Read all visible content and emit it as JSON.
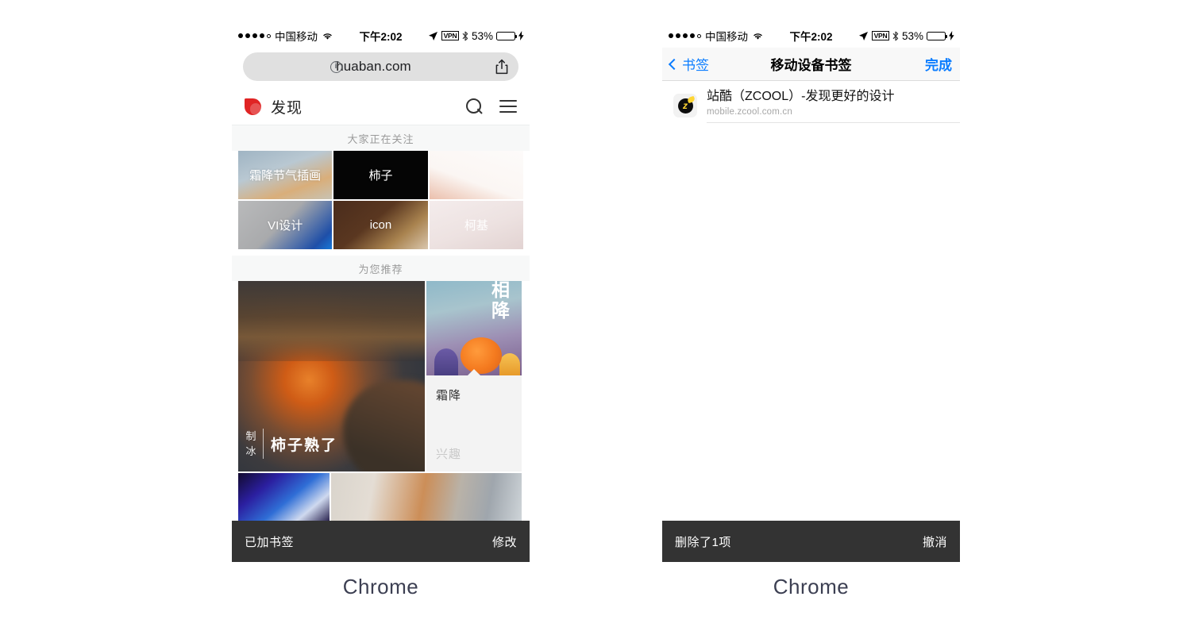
{
  "panels": [
    {
      "caption": "Chrome",
      "status_bar": {
        "signal_dots_filled": 4,
        "signal_dots_total": 5,
        "carrier": "中国移动",
        "wifi_icon": "wifi-icon",
        "time": "下午2:02",
        "location_icon": "location-arrow-icon",
        "vpn_label": "VPN",
        "bluetooth_icon": "bluetooth-icon",
        "battery_percent": "53%",
        "battery_fill": 55,
        "charging_icon": "lightning-bolt-icon"
      },
      "urlbar": {
        "info_icon": "info-circle-icon",
        "url": "huaban.com",
        "share_icon": "share-icon"
      },
      "site_header": {
        "logo_icon": "huaban-petal-logo",
        "title": "发现",
        "search_icon": "search-icon",
        "menu_icon": "hamburger-menu-icon"
      },
      "sections": [
        {
          "label": "大家正在关注"
        },
        {
          "label": "为您推荐"
        }
      ],
      "tags": [
        {
          "label": "霜降节气插画",
          "tone": "t1"
        },
        {
          "label": "柿子",
          "tone": "t2"
        },
        {
          "label": "",
          "tone": "t3"
        },
        {
          "label": "VI设计",
          "tone": "t4"
        },
        {
          "label": "icon",
          "tone": "t5"
        },
        {
          "label": "柯基",
          "tone": "t6"
        }
      ],
      "feed": {
        "main_photo_seal": "制\n冰",
        "main_photo_title": "柿子熟了",
        "illustration_text": "相\n降",
        "card_title": "霜降",
        "card_tag": "兴趣"
      },
      "toast": {
        "message": "已加书签",
        "action": "修改"
      }
    },
    {
      "caption": "Chrome",
      "status_bar": {
        "signal_dots_filled": 4,
        "signal_dots_total": 5,
        "carrier": "中国移动",
        "wifi_icon": "wifi-icon",
        "time": "下午2:02",
        "location_icon": "location-arrow-icon",
        "vpn_label": "VPN",
        "bluetooth_icon": "bluetooth-icon",
        "battery_percent": "53%",
        "battery_fill": 55,
        "charging_icon": "lightning-bolt-icon"
      },
      "navbar": {
        "back_icon": "chevron-left-icon",
        "back_label": "书签",
        "title": "移动设备书签",
        "done_label": "完成"
      },
      "bookmarks": [
        {
          "favicon": "zcool-favicon",
          "favicon_letter": "z",
          "title": "站酷（ZCOOL）-发现更好的设计",
          "url": "mobile.zcool.com.cn"
        }
      ],
      "toast": {
        "message": "删除了1项",
        "action": "撤消"
      }
    }
  ],
  "colors": {
    "ios_blue": "#0a7cff",
    "toast_bg": "#333333",
    "battery_green": "#4cd964",
    "huaban_red": "#e02424"
  }
}
